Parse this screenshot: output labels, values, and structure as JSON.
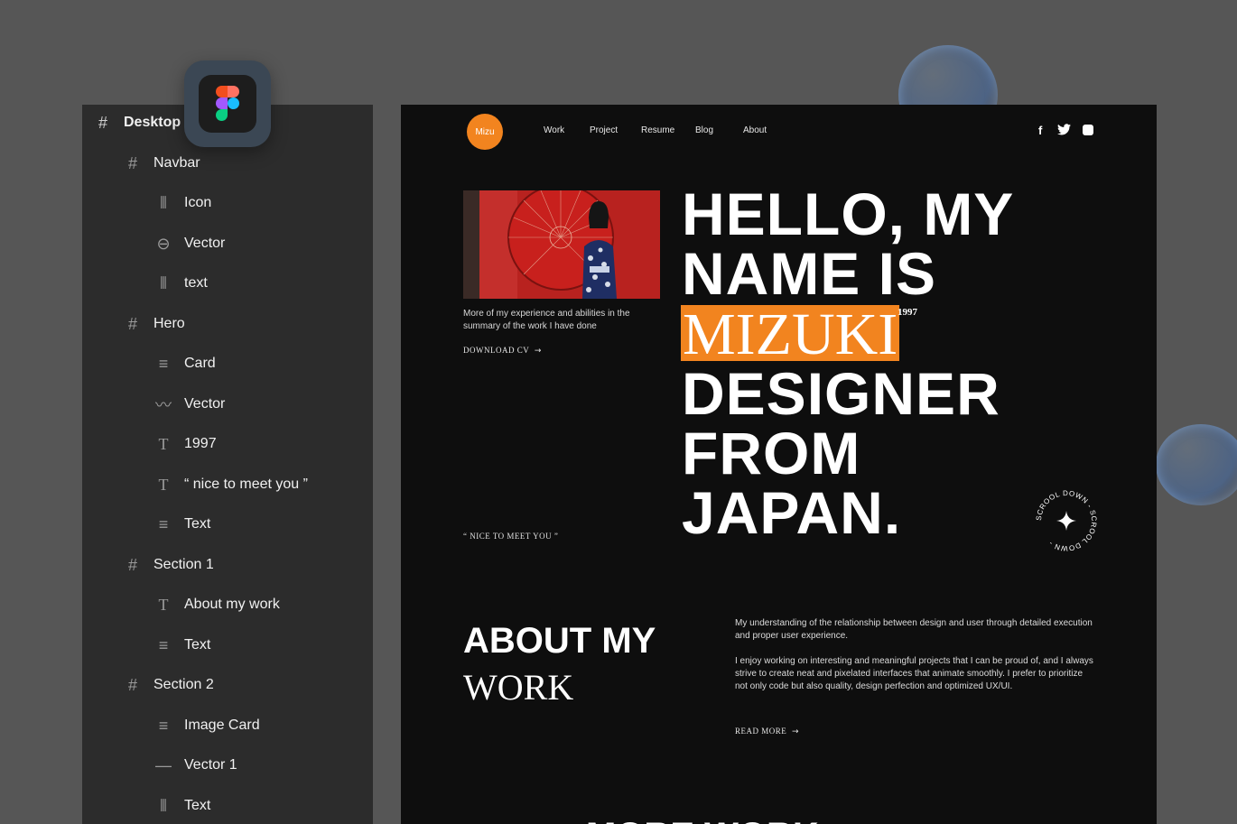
{
  "layers": {
    "items": [
      {
        "label": "Desktop",
        "icon": "frame-icon"
      },
      {
        "label": "Navbar",
        "icon": "frame-icon"
      },
      {
        "label": "Icon",
        "icon": "autolayout-icon"
      },
      {
        "label": "Vector",
        "icon": "vector-circle-icon"
      },
      {
        "label": "text",
        "icon": "autolayout-icon"
      },
      {
        "label": "Hero",
        "icon": "frame-icon"
      },
      {
        "label": "Card",
        "icon": "autolayout-rows-icon"
      },
      {
        "label": "Vector",
        "icon": "pen-vector-icon"
      },
      {
        "label": "1997",
        "icon": "text-icon"
      },
      {
        "label": "“ nice to meet you ”",
        "icon": "text-icon"
      },
      {
        "label": "Text",
        "icon": "autolayout-rows-icon"
      },
      {
        "label": "Section 1",
        "icon": "frame-icon"
      },
      {
        "label": "About my work",
        "icon": "text-icon"
      },
      {
        "label": "Text",
        "icon": "autolayout-rows-icon"
      },
      {
        "label": "Section 2",
        "icon": "frame-icon"
      },
      {
        "label": "Image Card",
        "icon": "autolayout-rows-icon"
      },
      {
        "label": "Vector 1",
        "icon": "line-icon"
      },
      {
        "label": "Text",
        "icon": "autolayout-icon"
      }
    ]
  },
  "figma": {
    "icon": "figma-logo-icon"
  },
  "site": {
    "logo": "Mizu",
    "nav": [
      "Work",
      "Project",
      "Resume",
      "Blog",
      "About"
    ],
    "social": [
      "facebook-icon",
      "twitter-icon",
      "instagram-icon"
    ],
    "intro": "More of my experience and abilities in the summary of the work I have done",
    "download": "DOWNLOAD CV",
    "nice": "“ NICE TO MEET YOU ”",
    "hero": {
      "line1": "HELLO, MY",
      "line2": "NAME IS",
      "name": "MIZUKI",
      "line3": "DESIGNER",
      "line4": "FROM",
      "line5": "JAPAN.",
      "year": "1997"
    },
    "scroll_text": "SCROOL DOWN - SCROOL DOWN -",
    "about": {
      "title1": "ABOUT MY",
      "title2": "WORK",
      "p1": "My understanding of the relationship between design and user through detailed execution and proper user experience.",
      "p2": "I enjoy working on interesting and meaningful projects that I can be proud of, and I always strive to create neat and pixelated interfaces that animate smoothly. I prefer to prioritize not only code but also quality, design perfection and optimized UX/UI.",
      "read_more": "READ MORE"
    },
    "more_heading": "MORE WORK",
    "accent": "#f2841f"
  }
}
